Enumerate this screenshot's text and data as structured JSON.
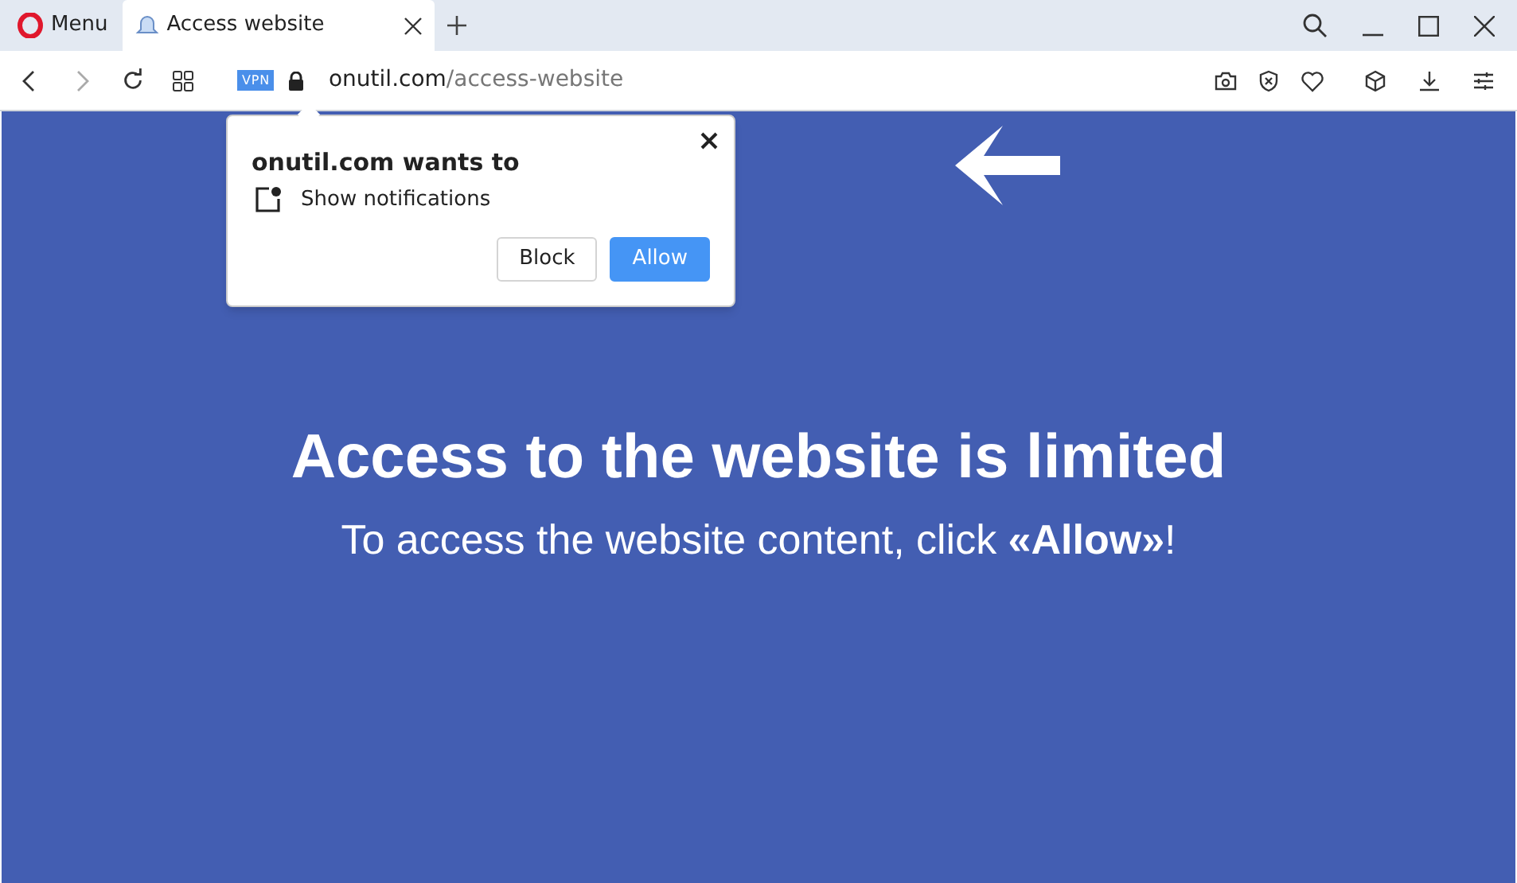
{
  "menu_button": {
    "label": "Menu"
  },
  "tabs": [
    {
      "title": "Access website",
      "selected": true
    }
  ],
  "address_bar": {
    "badge": "VPN",
    "domain": "onutil.com",
    "path": "/access-website"
  },
  "permission_popup": {
    "title": "onutil.com wants to",
    "permission": "Show notifications",
    "buttons": [
      {
        "label": "Block",
        "kind": "secondary"
      },
      {
        "label": "Allow",
        "kind": "primary"
      }
    ]
  },
  "page": {
    "heading": "Access to the website is limited",
    "message": "To access the website content, click **«Allow»**!"
  }
}
